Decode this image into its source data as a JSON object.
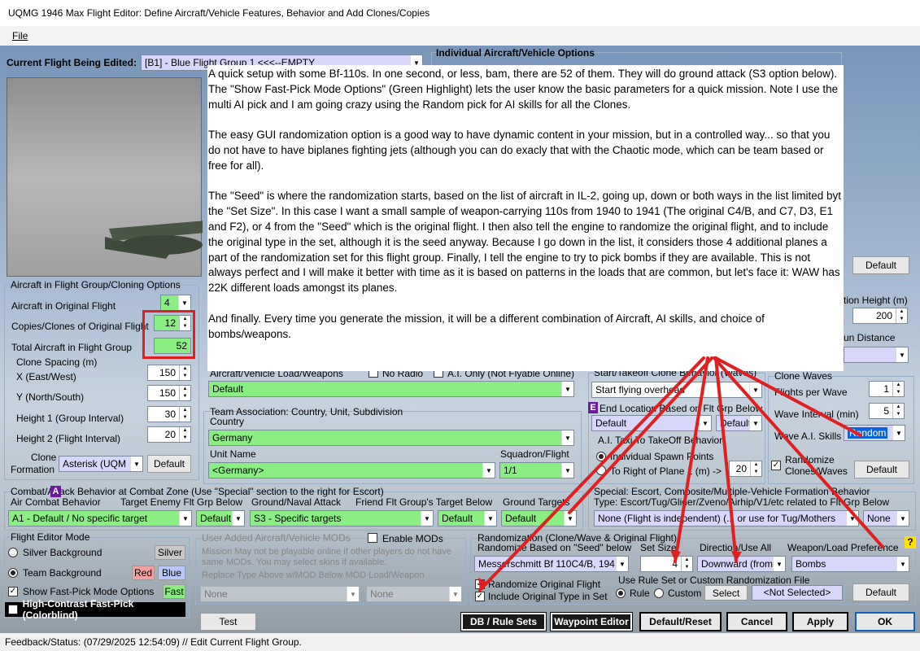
{
  "window": {
    "title": "UQMG 1946 Max Flight Editor:  Define Aircraft/Vehicle Features, Behavior and Add Clones/Copies"
  },
  "menu": {
    "file": "File"
  },
  "flight": {
    "label": "Current Flight Being Edited:",
    "value": "[B1] - Blue Flight Group  1     <<<--EMPTY"
  },
  "individual": {
    "title": "Individual Aircraft/Vehicle Options",
    "default_btn": "Default"
  },
  "cloning": {
    "title": "Aircraft in Flight Group/Cloning Options",
    "orig_label": "Aircraft in Original Flight",
    "orig_value": "4",
    "copies_label": "Copies/Clones of Original Flight",
    "copies_value": "12",
    "total_label": "Total Aircraft in Flight Group",
    "total_value": "52",
    "spacing_title": "Clone Spacing (m)",
    "x_label": "X (East/West)",
    "x_value": "150",
    "y_label": "Y (North/South)",
    "y_value": "150",
    "h1_label": "Height 1 (Group Interval)",
    "h1_value": "30",
    "h2_label": "Height 2 (Flight Interval)",
    "h2_value": "20",
    "formation_label1": "Clone",
    "formation_label2": "Formation",
    "formation_value": "Asterisk (UQM",
    "default_btn": "Default"
  },
  "load": {
    "label": "Aircraft/Vehicle Load/Weapons",
    "no_radio": "No Radio",
    "ai_only": "A.I. Only (Not Flyable Online)",
    "value": "Default"
  },
  "team": {
    "title": "Team Association:  Country, Unit, Subdivision",
    "country_label": "Country",
    "country_value": "Germany",
    "unit_label": "Unit Name",
    "unit_value": "<Germany>",
    "squadron_label": "Squadron/Flight",
    "squadron_value": "1/1"
  },
  "right_top": {
    "height_label": "tion Height (m)",
    "height_value": "200",
    "distance_label": "un Distance"
  },
  "start": {
    "title": "Start/Takeoff Clone Behavior (Waves)",
    "value": "Start flying overhead",
    "end_label": "End Location Based on Flt Grp Below",
    "end_badge": "E",
    "end_value": "Default",
    "end_value2": "Default",
    "taxi_title": "A.I. Taxi To TakeOff Behavior",
    "taxi_opt1": "Individual Spawn Points",
    "taxi_opt2": "To Right of Plane 1 (m) ->",
    "taxi_value": "20"
  },
  "waves": {
    "title": "Clone Waves",
    "fpw_label": "Flights per Wave",
    "fpw_value": "1",
    "interval_label": "Wave Interval (min)",
    "interval_value": "5",
    "skills_label": "Wave A.I. Skills",
    "skills_value": "Random",
    "randomize_label1": "Randomize",
    "randomize_label2": "Clones/Waves",
    "default_btn": "Default"
  },
  "combat": {
    "title": "Combat/Attack Behavior at Combat Zone (Use \"Special\" section to the right for Escort)",
    "badge": "A",
    "air_label": "Air Combat Behavior",
    "air_value": "A1 - Default / No specific target",
    "target_label": "Target Enemy Flt Grp Below",
    "target_value": "Default",
    "ground_label": "Ground/Naval Attack",
    "ground_value": "S3 - Specific targets",
    "friend_label": "Friend Flt Group's Target Below",
    "friend_value": "Default",
    "gt_label": "Ground Targets",
    "gt_value": "Default"
  },
  "special": {
    "title": "Special: Escort, Composite/Multiple-Vehicle Formation Behavior",
    "subtitle": "Type: Escort/Tug/Glider/Zveno/Airhip/V1/etc related to Flt Grp Below",
    "value": "None (Flight is independent) (... or use for Tug/Mothers",
    "value2": "None"
  },
  "mode": {
    "title": "Flight Editor Mode",
    "silver_label": "Silver Background",
    "silver_btn": "Silver",
    "team_label": "Team Background",
    "red_btn": "Red",
    "blue_btn": "Blue",
    "fast_label": "Show Fast-Pick Mode Options",
    "fast_btn": "Fast",
    "contrast_label": "High-Contrast Fast-Pick (Colorblind)"
  },
  "mods": {
    "title": "User Added Aircraft/Vehicle MODs",
    "enable_label": "Enable MODs",
    "desc": "Mission May not be playable online if other players do not have same MODs.  You may select skins if available.",
    "replace_label": "Replace Type Above w/MOD Below   MOD Load/Weapon",
    "v1": "None",
    "v2": "None"
  },
  "random": {
    "title": "Randomization (Clone/Wave & Original Flight)",
    "seed_label": "Randomize Based on \"Seed\" below",
    "seed_value": "Messerschmitt Bf 110C4/B, 194",
    "set_label": "Set Size",
    "set_value": "4",
    "dir_label": "Direction/Use All",
    "dir_value": "Downward (from",
    "weapon_label": "Weapon/Load Preference",
    "weapon_value": "Bombs",
    "help": "?",
    "orig_label": "Randomize Original Flight",
    "incl_label": "Include Original Type in Set",
    "rule_title": "Use Rule Set or Custom Randomization File",
    "rule_label": "Rule",
    "custom_label": "Custom",
    "select_btn": "Select",
    "not_selected": "<Not Selected>",
    "default_btn": "Default"
  },
  "buttons": {
    "test": "Test",
    "db": "DB / Rule Sets",
    "waypoint": "Waypoint Editor",
    "reset": "Default/Reset",
    "cancel": "Cancel",
    "apply": "Apply",
    "ok": "OK"
  },
  "status": {
    "text": "Feedback/Status:  (07/29/2025 12:54:09) // Edit Current Flight Group."
  },
  "overlay": {
    "text": "A quick setup with some Bf-110s.  In one second, or less, bam, there are 52 of them.  They will do ground attack (S3 option below).  The \"Show Fast-Pick Mode Options\" (Green Highlight) lets the user know the basic parameters for a quick mission.  Note I use the multi AI pick and I am going crazy using the Random pick for AI skills for all the Clones.\n\nThe easy GUI randomization option is a good way to have dynamic content in your mission, but in a controlled way... so that you do not have to have biplanes fighting jets (although you can do exacly that with the Chaotic mode, which can be team based or free for all).\n\nThe \"Seed\" is where the randomization starts, based on the list of aircraft in IL-2, going up, down or both ways in the list limited byt the \"Set Size\".  In this case I want a small sample of weapon-carrying 110s from 1940 to 1941 (The original C4/B, and C7, D3, E1 and F2), or 4 from the \"Seed\" which is the original flight.  I then also tell the engine to randomize the original flight, and to include the original type in the set, although it is the seed anyway.  Because I go down in the list, it considers those 4 additional planes a part of the randomization set for this flight group.  Finally, I tell the engine to try to pick bombs if they are available.  This is not always perfect and I will make it better with time as it is based on patterns in the loads that are common, but let's face it:  WAW has 22K different loads amongst its planes.\n\nAnd finally.  Every time you generate the mission, it will be a different combination of Aircraft, AI skills, and choice of bombs/weapons."
  },
  "colors": {
    "highlight_green": "#8bee82",
    "annotation_red": "#e02020",
    "lavender": "#d8d6fa"
  }
}
